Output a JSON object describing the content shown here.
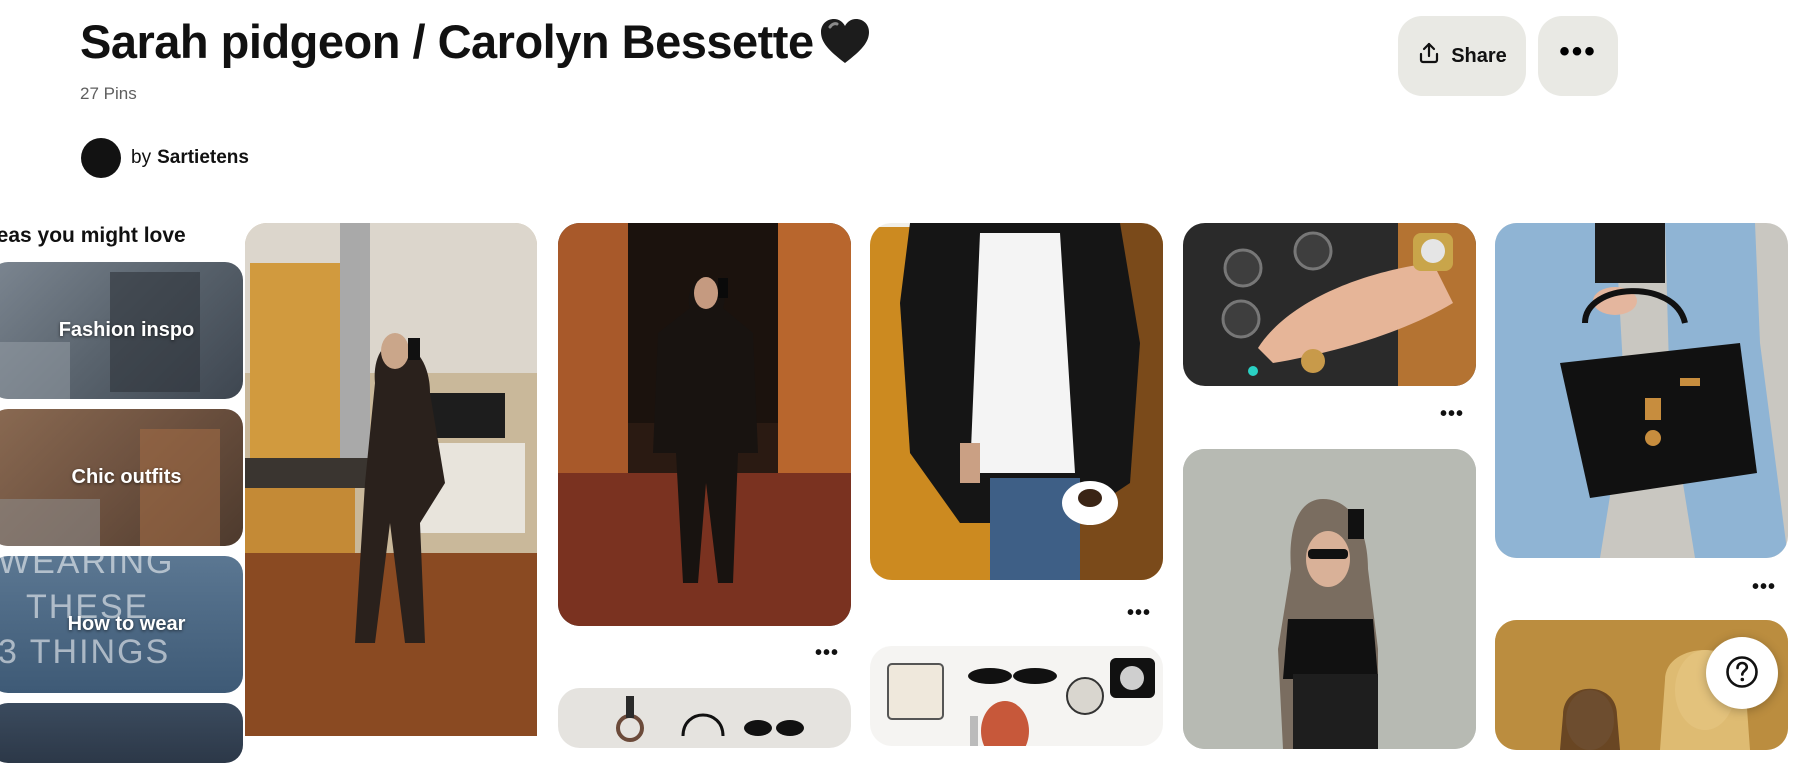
{
  "board": {
    "title": "Sarah pidgeon / Carolyn Bessette",
    "title_emoji_icon": "black-heart-icon",
    "pin_count": "27 Pins",
    "owner_prefix": "by",
    "owner_name": "Sartietens"
  },
  "actions": {
    "share_label": "Share",
    "share_icon": "share-upload-icon",
    "more_icon": "ellipsis-icon",
    "more_glyph": "•••"
  },
  "ideas": {
    "heading": "Ideas you might love",
    "cards": [
      {
        "label": "Fashion inspo"
      },
      {
        "label": "Chic outfits"
      },
      {
        "label": "How to wear",
        "overlay_text": [
          "WEARING",
          "THESE",
          "3 THINGS"
        ]
      }
    ]
  },
  "pin_more_glyph": "•••",
  "help_icon": "question-mark-icon",
  "colors": {
    "button_bg": "#e9e9e4",
    "text_primary": "#111111",
    "text_secondary": "#5f5f5f"
  }
}
